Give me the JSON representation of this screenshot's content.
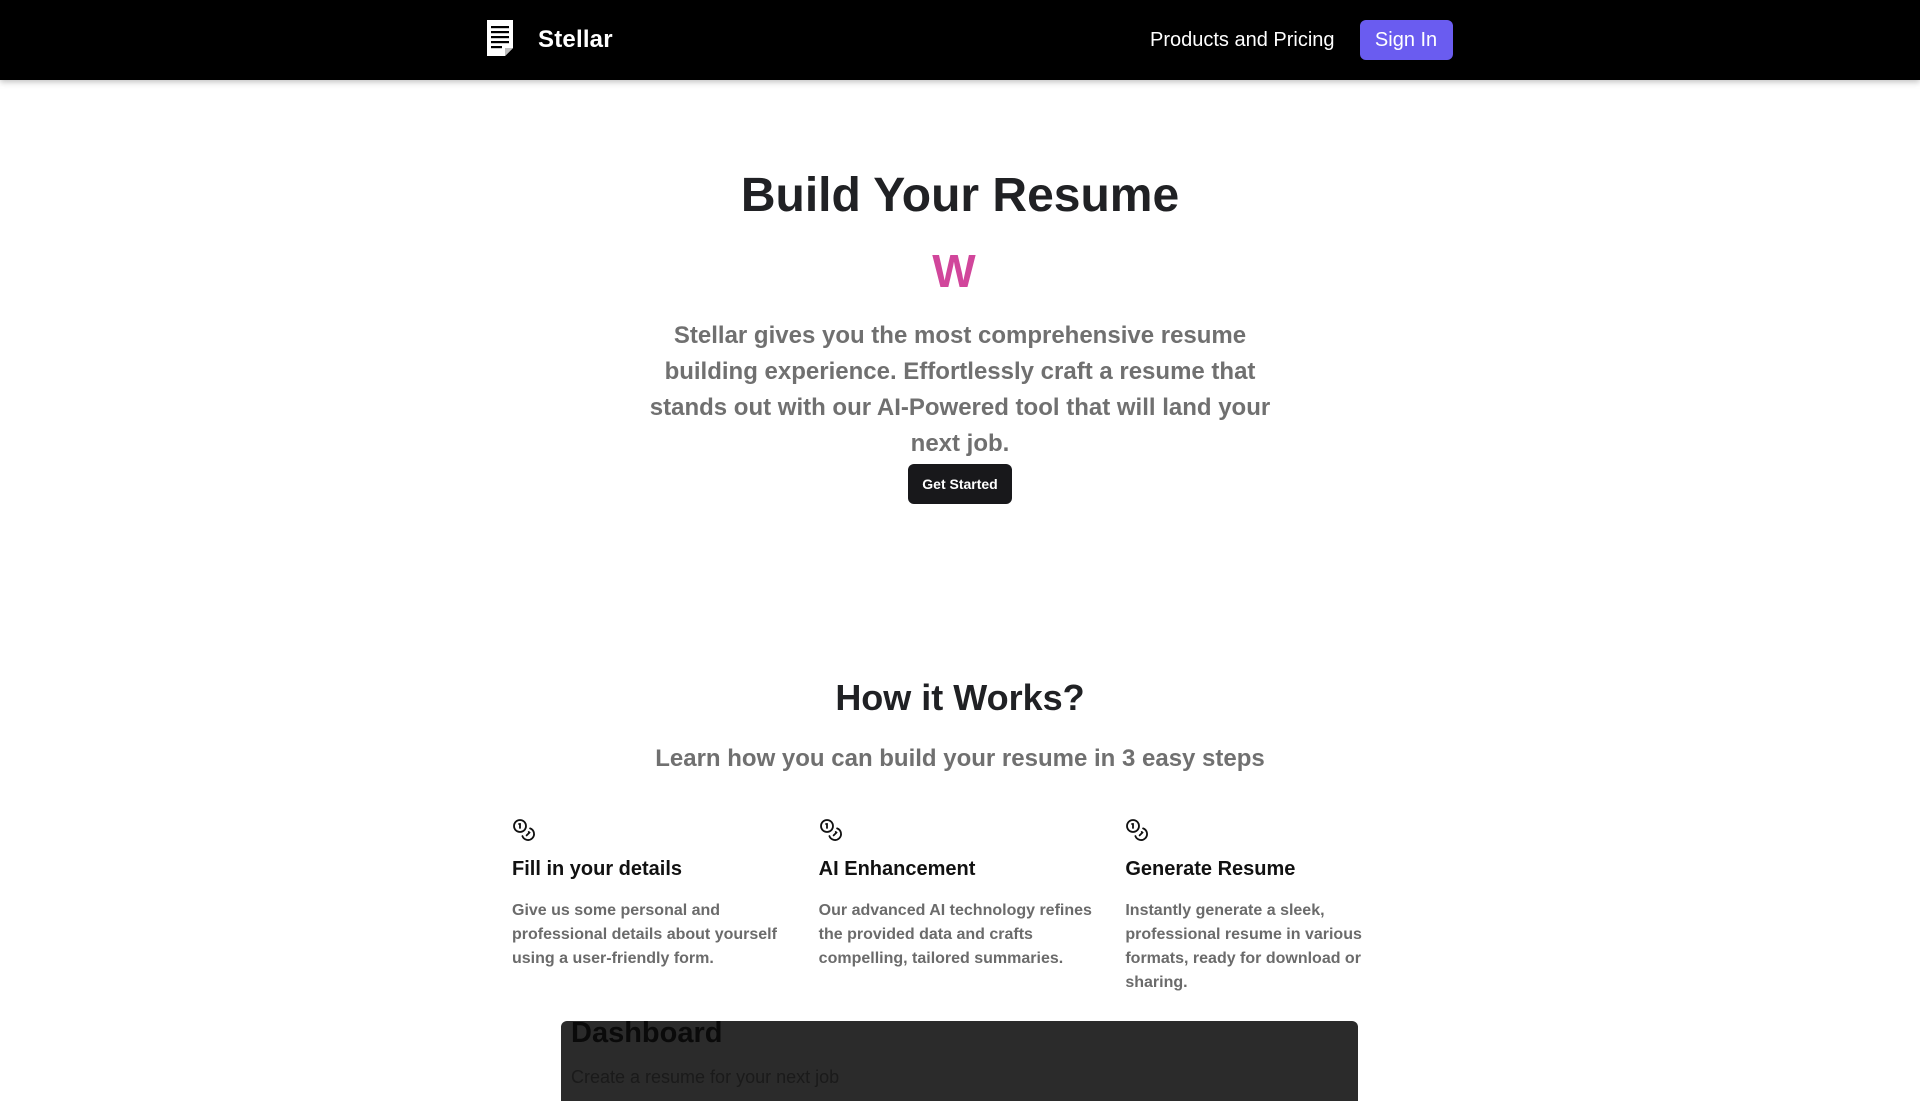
{
  "nav": {
    "brand": "Stellar",
    "brand_icon": "document-icon",
    "products_link": "Products and Pricing",
    "signin_label": "Sign In"
  },
  "hero": {
    "title": "Build Your Resume",
    "typed_text": "W",
    "description": "Stellar gives you the most comprehensive resume building experience. Effortlessly craft a resume that stands out with our AI-Powered tool that will land your next job.",
    "cta_label": "Get Started"
  },
  "how": {
    "title": "How it Works?",
    "subtitle": "Learn how you can build your resume in 3 easy steps",
    "steps": [
      {
        "icon": "coins-icon",
        "title": "Fill in your details",
        "description": "Give us some personal and professional details about yourself using a user-friendly form."
      },
      {
        "icon": "coins-icon",
        "title": "AI Enhancement",
        "description": "Our advanced AI technology refines the provided data and crafts compelling, tailored summaries."
      },
      {
        "icon": "coins-icon",
        "title": "Generate Resume",
        "description": "Instantly generate a sleek, professional resume in various formats, ready for download or sharing."
      }
    ]
  },
  "preview": {
    "title": "Dashboard",
    "subtitle": "Create a resume for your next job"
  },
  "colors": {
    "navbar": "#000000",
    "signin": "#6a5cf0",
    "typed": "#d1469b",
    "muted_text": "#707070",
    "cta": "#18181b",
    "preview_bg": "#2b2b2b"
  }
}
